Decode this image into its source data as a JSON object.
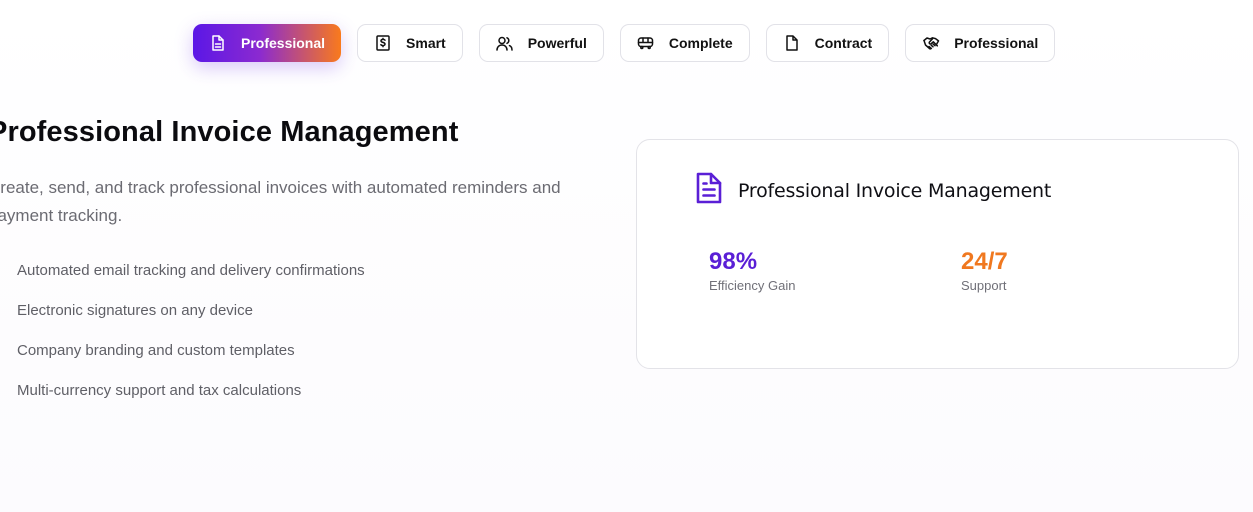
{
  "tabs": [
    {
      "label": "Professional",
      "icon": "file-text-icon",
      "active": true
    },
    {
      "label": "Smart",
      "icon": "dollar-receipt-icon",
      "active": false
    },
    {
      "label": "Powerful",
      "icon": "users-icon",
      "active": false
    },
    {
      "label": "Complete",
      "icon": "bus-icon",
      "active": false
    },
    {
      "label": "Contract",
      "icon": "file-icon",
      "active": false
    },
    {
      "label": "Professional",
      "icon": "handshake-icon",
      "active": false
    }
  ],
  "hero": {
    "title": "Professional Invoice Management",
    "description": "Create, send, and track professional invoices with automated reminders and payment tracking.",
    "features": [
      "Automated email tracking and delivery confirmations",
      "Electronic signatures on any device",
      "Company branding and custom templates",
      "Multi-currency support and tax calculations"
    ]
  },
  "card": {
    "title": "Professional Invoice Management",
    "icon": "document-icon",
    "stats": [
      {
        "value": "98%",
        "label": "Efficiency Gain",
        "color": "#5a1fd6"
      },
      {
        "value": "24/7",
        "label": "Support",
        "color": "#f0781f"
      }
    ]
  },
  "colors": {
    "accent_start": "#5b17e6",
    "accent_end": "#f97a1c",
    "check": "#2fb36b"
  }
}
